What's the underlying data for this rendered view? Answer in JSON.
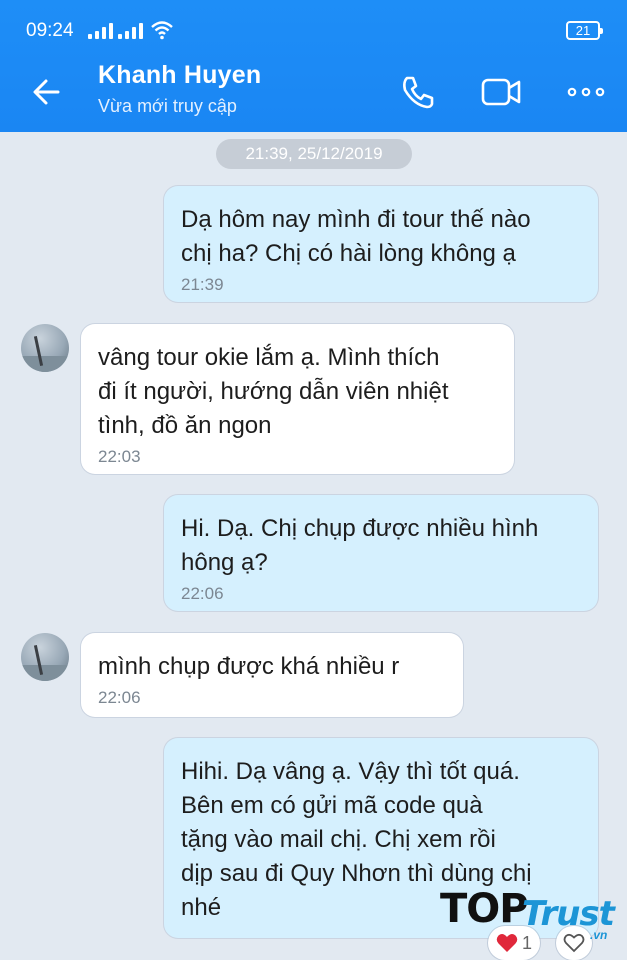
{
  "status": {
    "time": "09:24",
    "battery": "21"
  },
  "header": {
    "name": "Khanh Huyen",
    "subtitle": "Vừa mới truy cập"
  },
  "date_separator": "21:39, 25/12/2019",
  "messages": [
    {
      "dir": "out",
      "text": "Dạ hôm nay mình đi tour thế nào\nchị ha? Chị có hài lòng không ạ",
      "time": "21:39"
    },
    {
      "dir": "in",
      "text": "vâng tour okie lắm ạ. Mình thích\nđi ít người, hướng dẫn viên nhiệt\ntình, đồ ăn ngon",
      "time": "22:03"
    },
    {
      "dir": "out",
      "text": "Hi. Dạ. Chị chụp được nhiều hình\nhông ạ?",
      "time": "22:06"
    },
    {
      "dir": "in",
      "text": "mình chụp được khá nhiều r",
      "time": "22:06"
    },
    {
      "dir": "out",
      "text": "Hihi. Dạ vâng ạ. Vậy thì tốt quá.\nBên em có gửi mã code quà\ntặng vào mail chị. Chị xem rồi\ndịp sau đi Quy Nhơn thì dùng chị\nnhé",
      "time": ""
    }
  ],
  "reactions": {
    "heart_count": "1"
  },
  "watermark": {
    "top": "TOP",
    "trust": "Trust",
    "vn": ".vn"
  },
  "colors": {
    "header": "#1a86f3",
    "outgoing_bubble": "#d5f0fe",
    "incoming_bubble": "#ffffff",
    "background": "#e2e9f1"
  },
  "icons": [
    "back-arrow-icon",
    "phone-icon",
    "video-call-icon",
    "more-icon",
    "heart-icon",
    "heart-outline-icon"
  ]
}
